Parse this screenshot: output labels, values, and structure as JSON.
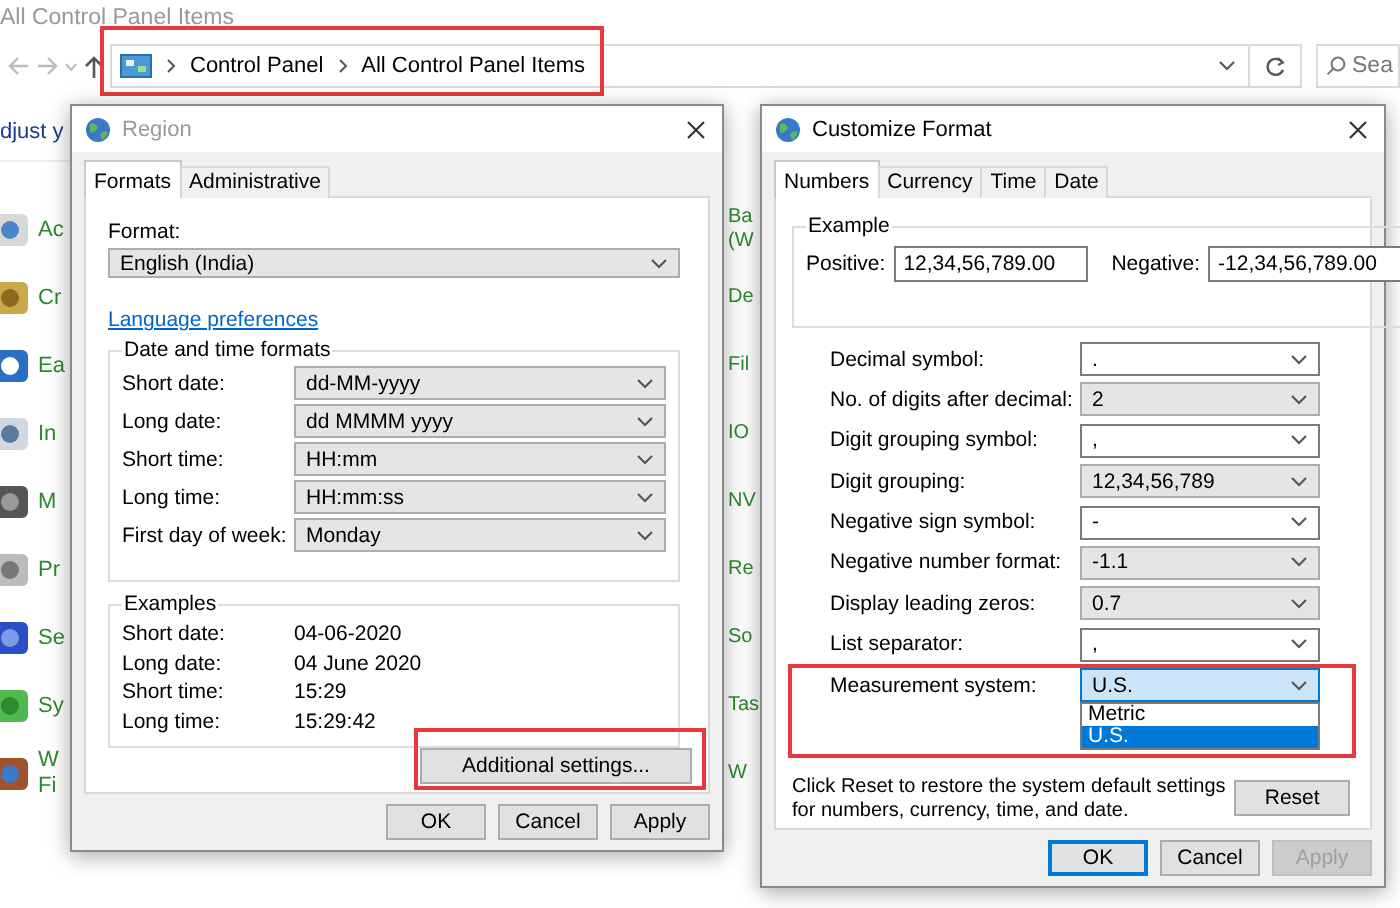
{
  "explorer": {
    "title": "All Control Panel Items",
    "breadcrumb": [
      "Control Panel",
      "All Control Panel Items"
    ],
    "address_highlighted": true,
    "search": {
      "placeholder": "Sea"
    },
    "heading": "djust y",
    "left_items": [
      {
        "lines": [
          "Ac"
        ]
      },
      {
        "lines": [
          "Cr"
        ]
      },
      {
        "lines": [
          "Ea"
        ]
      },
      {
        "lines": [
          "In"
        ]
      },
      {
        "lines": [
          "M"
        ]
      },
      {
        "lines": [
          "Pr"
        ]
      },
      {
        "lines": [
          "Se"
        ]
      },
      {
        "lines": [
          "Sy"
        ]
      },
      {
        "lines": [
          "W",
          "Fi"
        ]
      }
    ],
    "right_items": [
      {
        "lines": [
          "Ba",
          "(W"
        ]
      },
      {
        "lines": [
          "De"
        ]
      },
      {
        "lines": [
          "Fil"
        ]
      },
      {
        "lines": [
          "IO"
        ]
      },
      {
        "lines": [
          "NV"
        ]
      },
      {
        "lines": [
          "Re"
        ]
      },
      {
        "lines": [
          "So"
        ]
      },
      {
        "lines": [
          "Tas"
        ]
      },
      {
        "lines": [
          "W"
        ]
      }
    ]
  },
  "region": {
    "title": "Region",
    "active": false,
    "tabs": [
      {
        "label": "Formats",
        "selected": true
      },
      {
        "label": "Administrative",
        "selected": false
      }
    ],
    "format_label": "Format:",
    "format_value": "English (India)",
    "link": "Language preferences",
    "date_time_group": "Date and time formats",
    "date_time": [
      {
        "label": "Short date:",
        "value": "dd-MM-yyyy"
      },
      {
        "label": "Long date:",
        "value": "dd MMMM yyyy"
      },
      {
        "label": "Short time:",
        "value": "HH:mm"
      },
      {
        "label": "Long time:",
        "value": "HH:mm:ss"
      },
      {
        "label": "First day of week:",
        "value": "Monday"
      }
    ],
    "examples_group": "Examples",
    "examples": [
      {
        "label": "Short date:",
        "value": "04-06-2020"
      },
      {
        "label": "Long date:",
        "value": "04 June 2020"
      },
      {
        "label": "Short time:",
        "value": "15:29"
      },
      {
        "label": "Long time:",
        "value": "15:29:42"
      }
    ],
    "additional": {
      "label": "Additional settings...",
      "highlighted": true
    },
    "buttons": [
      {
        "label": "OK",
        "default": false,
        "disabled": false
      },
      {
        "label": "Cancel",
        "default": false,
        "disabled": false
      },
      {
        "label": "Apply",
        "default": false,
        "disabled": false
      }
    ]
  },
  "customize": {
    "title": "Customize Format",
    "active": true,
    "tabs": [
      {
        "label": "Numbers",
        "selected": true
      },
      {
        "label": "Currency",
        "selected": false
      },
      {
        "label": "Time",
        "selected": false
      },
      {
        "label": "Date",
        "selected": false
      }
    ],
    "example_group": "Example",
    "positive_label": "Positive:",
    "positive_value": "12,34,56,789.00",
    "negative_label": "Negative:",
    "negative_value": "-12,34,56,789.00",
    "settings": [
      {
        "label": "Decimal symbol:",
        "value": ".",
        "kind": "edit",
        "open": false,
        "highlighted": false
      },
      {
        "label": "No. of digits after decimal:",
        "value": "2",
        "kind": "list",
        "open": false,
        "highlighted": false
      },
      {
        "label": "Digit grouping symbol:",
        "value": ",",
        "kind": "edit",
        "open": false,
        "highlighted": false
      },
      {
        "label": "Digit grouping:",
        "value": "12,34,56,789",
        "kind": "list",
        "open": false,
        "highlighted": false
      },
      {
        "label": "Negative sign symbol:",
        "value": "-",
        "kind": "edit",
        "open": false,
        "highlighted": false
      },
      {
        "label": "Negative number format:",
        "value": "-1.1",
        "kind": "list",
        "open": false,
        "highlighted": false
      },
      {
        "label": "Display leading zeros:",
        "value": "0.7",
        "kind": "list",
        "open": false,
        "highlighted": false
      },
      {
        "label": "List separator:",
        "value": ",",
        "kind": "edit",
        "open": false,
        "highlighted": false
      },
      {
        "label": "Measurement system:",
        "value": "U.S.",
        "kind": "list",
        "open": true,
        "highlighted": true,
        "options": [
          {
            "label": "Metric",
            "selected": false
          },
          {
            "label": "U.S.",
            "selected": true
          }
        ]
      }
    ],
    "note": "Click Reset to restore the system default settings for numbers, currency, time, and date.",
    "reset": "Reset",
    "buttons": [
      {
        "label": "OK",
        "default": true,
        "disabled": false
      },
      {
        "label": "Cancel",
        "default": false,
        "disabled": false
      },
      {
        "label": "Apply",
        "default": false,
        "disabled": true
      }
    ]
  }
}
